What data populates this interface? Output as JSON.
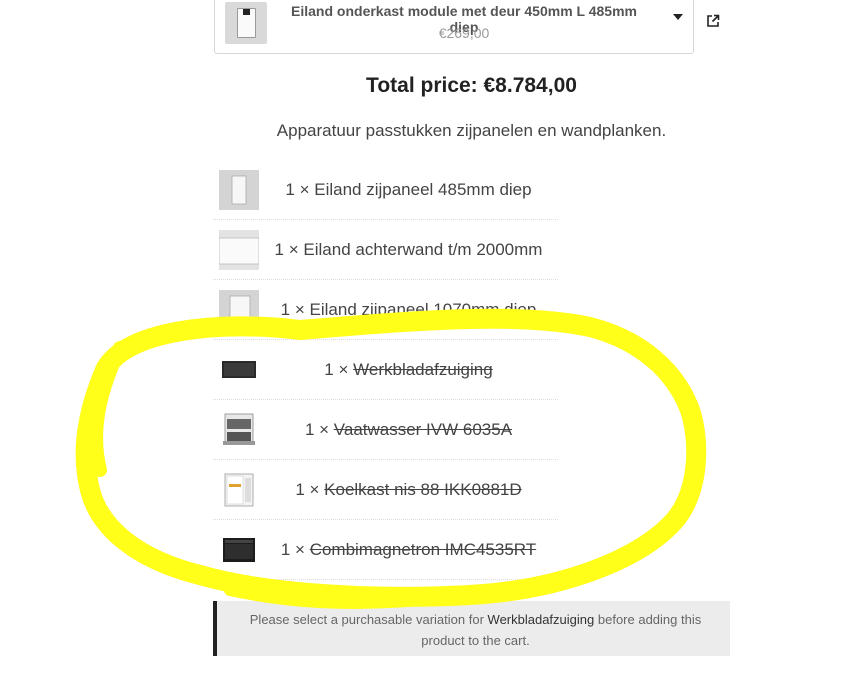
{
  "selector": {
    "product_name": "Eiland onderkast module met deur 450mm L 485mm diep",
    "price": "€269,00"
  },
  "total_price": "Total price: €8.784,00",
  "subtitle": "Apparatuur passtukken zijpanelen en wandplanken.",
  "items": [
    {
      "qty": "1 ×",
      "name": "Eiland zijpaneel 485mm diep",
      "unavailable": false
    },
    {
      "qty": "1 ×",
      "name": "Eiland achterwand t/m 2000mm",
      "unavailable": false
    },
    {
      "qty": "1 ×",
      "name": "Eiland zijpaneel 1070mm diep",
      "unavailable": false
    },
    {
      "qty": "1 ×",
      "name": "Werkbladafzuiging",
      "unavailable": true
    },
    {
      "qty": "1 ×",
      "name": "Vaatwasser IVW 6035A",
      "unavailable": true
    },
    {
      "qty": "1 ×",
      "name": "Koelkast nis 88 IKK0881D",
      "unavailable": true
    },
    {
      "qty": "1 ×",
      "name": "Combimagnetron IMC4535RT",
      "unavailable": true
    }
  ],
  "notice": {
    "before": "Please select a purchasable variation for",
    "product": "Werkbladafzuiging",
    "after": "before adding this product to the cart."
  },
  "colors": {
    "highlight": "#ffff1a",
    "notice_bg": "#ececec",
    "notice_border": "#222222"
  }
}
